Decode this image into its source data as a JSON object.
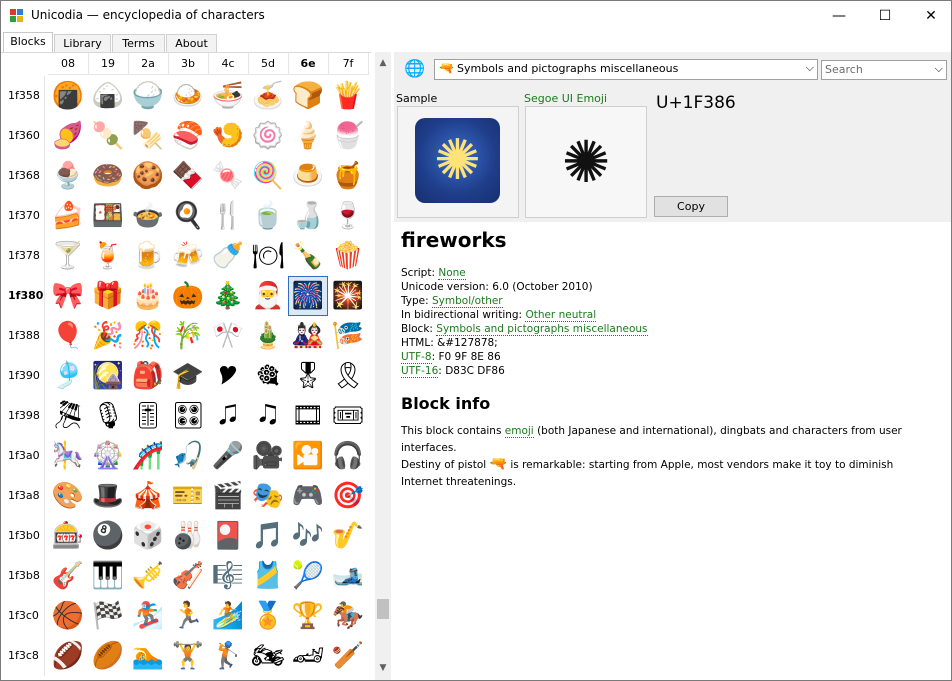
{
  "window": {
    "title": "Unicodia — encyclopedia of characters",
    "controls": {
      "minimize": "—",
      "maximize": "☐",
      "close": "✕"
    }
  },
  "tabs": [
    "Blocks",
    "Library",
    "Terms",
    "About"
  ],
  "grid": {
    "columns": [
      "08",
      "19",
      "2a",
      "3b",
      "4c",
      "5d",
      "6e",
      "7f"
    ],
    "bold_column": "6e",
    "bold_row": "1f380",
    "selected": {
      "row": 5,
      "col": 6
    },
    "rows": [
      {
        "label": "1f358",
        "glyphs": [
          "🍘",
          "🍙",
          "🍚",
          "🍛",
          "🍜",
          "🍝",
          "🍞",
          "🍟"
        ]
      },
      {
        "label": "1f360",
        "glyphs": [
          "🍠",
          "🍡",
          "🍢",
          "🍣",
          "🍤",
          "🍥",
          "🍦",
          "🍧"
        ]
      },
      {
        "label": "1f368",
        "glyphs": [
          "🍨",
          "🍩",
          "🍪",
          "🍫",
          "🍬",
          "🍭",
          "🍮",
          "🍯"
        ]
      },
      {
        "label": "1f370",
        "glyphs": [
          "🍰",
          "🍱",
          "🍲",
          "🍳",
          "🍴",
          "🍵",
          "🍶",
          "🍷"
        ]
      },
      {
        "label": "1f378",
        "glyphs": [
          "🍸",
          "🍹",
          "🍺",
          "🍻",
          "🍼",
          "🍽",
          "🍾",
          "🍿"
        ]
      },
      {
        "label": "1f380",
        "glyphs": [
          "🎀",
          "🎁",
          "🎂",
          "🎃",
          "🎄",
          "🎅",
          "🎆",
          "🎇"
        ]
      },
      {
        "label": "1f388",
        "glyphs": [
          "🎈",
          "🎉",
          "🎊",
          "🎋",
          "🎌",
          "🎍",
          "🎎",
          "🎏"
        ]
      },
      {
        "label": "1f390",
        "glyphs": [
          "🎐",
          "🎑",
          "🎒",
          "🎓",
          "🎔",
          "🎕",
          "🎖",
          "🎗"
        ]
      },
      {
        "label": "1f398",
        "glyphs": [
          "🎘",
          "🎙",
          "🎚",
          "🎛",
          "🎜",
          "🎝",
          "🎞",
          "🎟"
        ]
      },
      {
        "label": "1f3a0",
        "glyphs": [
          "🎠",
          "🎡",
          "🎢",
          "🎣",
          "🎤",
          "🎥",
          "🎦",
          "🎧"
        ]
      },
      {
        "label": "1f3a8",
        "glyphs": [
          "🎨",
          "🎩",
          "🎪",
          "🎫",
          "🎬",
          "🎭",
          "🎮",
          "🎯"
        ]
      },
      {
        "label": "1f3b0",
        "glyphs": [
          "🎰",
          "🎱",
          "🎲",
          "🎳",
          "🎴",
          "🎵",
          "🎶",
          "🎷"
        ]
      },
      {
        "label": "1f3b8",
        "glyphs": [
          "🎸",
          "🎹",
          "🎺",
          "🎻",
          "🎼",
          "🎽",
          "🎾",
          "🎿"
        ]
      },
      {
        "label": "1f3c0",
        "glyphs": [
          "🏀",
          "🏁",
          "🏂",
          "🏃",
          "🏄",
          "🏅",
          "🏆",
          "🏇"
        ]
      },
      {
        "label": "1f3c8",
        "glyphs": [
          "🏈",
          "🏉",
          "🏊",
          "🏋",
          "🏌",
          "🏍",
          "🏎",
          "🏏"
        ]
      }
    ]
  },
  "toolbar": {
    "block_selector": "Symbols and pictographs miscellaneous",
    "search_placeholder": "Search"
  },
  "preview": {
    "sample_label": "Sample",
    "font_label": "Segoe UI Emoji",
    "codepoint": "U+1F386",
    "copy_label": "Copy",
    "glyph": "🎆",
    "font_glyph": "✺"
  },
  "info": {
    "name": "fireworks",
    "properties": [
      {
        "key": "Script:",
        "value": "None",
        "key_link": false,
        "value_link": true
      },
      {
        "key": "Unicode version:",
        "value": "6.0 (October 2010)",
        "key_link": false,
        "value_link": false
      },
      {
        "key": "Type:",
        "value": "Symbol/other",
        "key_link": false,
        "value_link": true
      },
      {
        "key": "In bidirectional writing:",
        "value": "Other neutral",
        "key_link": false,
        "value_link": true
      },
      {
        "key": "Block:",
        "value": "Symbols and pictographs miscellaneous",
        "key_link": false,
        "value_link": true
      },
      {
        "key": "HTML:",
        "value": "&#127878;",
        "key_link": false,
        "value_link": false
      },
      {
        "key": "UTF-8",
        "value": "F0 9F 8E 86",
        "key_link": true,
        "value_link": false
      },
      {
        "key": "UTF-16",
        "value": "D83C DF86",
        "key_link": true,
        "value_link": false
      }
    ],
    "block_info_heading": "Block info",
    "para1": {
      "pre": "This block contains ",
      "link": "emoji",
      "post": " (both Japanese and international), dingbats and characters from user interfaces."
    },
    "para2": {
      "pre": "Destiny of pistol ",
      "glyph": "🔫",
      "post": " is remarkable: starting from Apple, most vendors make it toy to diminish Internet threatenings."
    }
  },
  "colors": {
    "link": "#1b7a1b",
    "selection_border": "#2f6fc0",
    "selection_fill": "#dbe8f8",
    "toolbar_bg": "#f0f0f0"
  }
}
